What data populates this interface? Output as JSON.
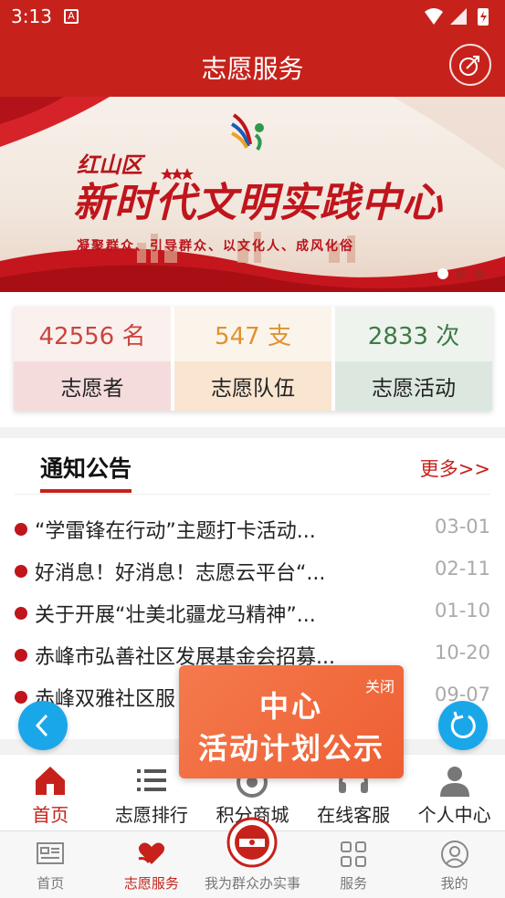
{
  "status_bar": {
    "time": "3:13",
    "app_badge": "A"
  },
  "header": {
    "title": "志愿服务"
  },
  "banner": {
    "district": "红山区",
    "title": "新时代文明实践中心",
    "subtitle": "凝聚群众、引导群众、以文化人、成风化俗",
    "slides": 3,
    "active_slide": 1
  },
  "stats": [
    {
      "value": "42556 名",
      "label": "志愿者"
    },
    {
      "value": "547 支",
      "label": "志愿队伍"
    },
    {
      "value": "2833 次",
      "label": "志愿活动"
    }
  ],
  "notice": {
    "title": "通知公告",
    "more": "更多>>",
    "items": [
      {
        "text": "“学雷锋在行动”主题打卡活动...",
        "date": "03-01"
      },
      {
        "text": "好消息！好消息！志愿云平台“...",
        "date": "02-11"
      },
      {
        "text": "关于开展“壮美北疆龙马精神”...",
        "date": "01-10"
      },
      {
        "text": "赤峰市弘善社区发展基金会招募...",
        "date": "10-20"
      },
      {
        "text": "赤峰双雅社区服",
        "date": "09-07"
      }
    ]
  },
  "popup": {
    "close": "关闭",
    "line1": "中心",
    "line2": "活动计划公示"
  },
  "quick_nav": [
    {
      "label": "首页",
      "icon": "home-icon",
      "active": true
    },
    {
      "label": "志愿排行",
      "icon": "ranking-list-icon",
      "active": false
    },
    {
      "label": "积分商城",
      "icon": "points-mall-icon",
      "active": false
    },
    {
      "label": "在线客服",
      "icon": "customer-service-icon",
      "active": false
    },
    {
      "label": "个人中心",
      "icon": "user-icon",
      "active": false
    }
  ],
  "tab_bar": [
    {
      "label": "首页",
      "icon": "news-icon",
      "active": false
    },
    {
      "label": "志愿服务",
      "icon": "heart-hands-icon",
      "active": true
    },
    {
      "label": "我为群众办实事",
      "icon": "emblem-icon",
      "active": false
    },
    {
      "label": "服务",
      "icon": "grid-icon",
      "active": false
    },
    {
      "label": "我的",
      "icon": "profile-icon",
      "active": false
    }
  ],
  "colors": {
    "brand": "#c6221b",
    "fab": "#1aa7ea",
    "popup": "#ee5f33"
  }
}
